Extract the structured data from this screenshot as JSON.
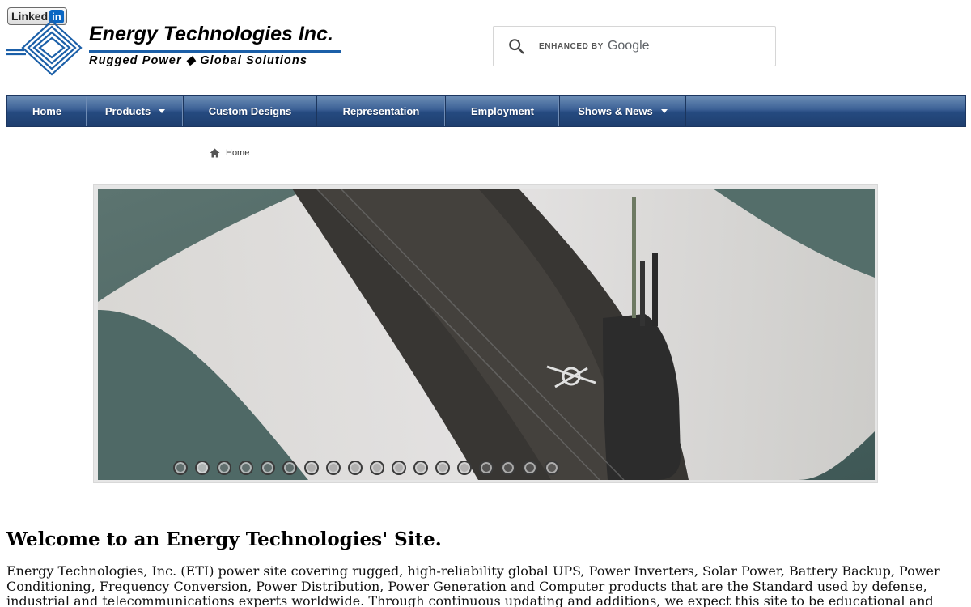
{
  "header": {
    "linkedin_text": "Linked",
    "linkedin_in": "in",
    "company_name": "Energy Technologies Inc.",
    "tagline": "Rugged Power ◆ Global Solutions",
    "brand_color": "#1b5fa8"
  },
  "search": {
    "enhanced_label": "ENHANCED BY",
    "brand": "Google",
    "icon": "search-icon"
  },
  "nav": {
    "items": [
      {
        "label": "Home",
        "has_dropdown": false
      },
      {
        "label": "Products",
        "has_dropdown": true
      },
      {
        "label": "Custom Designs",
        "has_dropdown": false
      },
      {
        "label": "Representation",
        "has_dropdown": false
      },
      {
        "label": "Employment",
        "has_dropdown": false
      },
      {
        "label": "Shows & News",
        "has_dropdown": true
      }
    ]
  },
  "breadcrumb": {
    "icon": "home-icon",
    "label": "Home"
  },
  "slider": {
    "slide_count": 18,
    "active_index": 1
  },
  "content": {
    "title": "Welcome to an Energy Technologies' Site.",
    "intro": "Energy Technologies, Inc. (ETI) power site covering rugged, high-reliability global UPS, Power Inverters, Solar Power, Battery Backup, Power Conditioning, Frequency Conversion, Power Distribution, Power Generation and Computer products that are the Standard used by defense, industrial and telecommunications experts worldwide. Through continuous updating and additions, we expect this site to be educational and informative on the subject of high reliability applications and the associated power conditioning and computer"
  }
}
